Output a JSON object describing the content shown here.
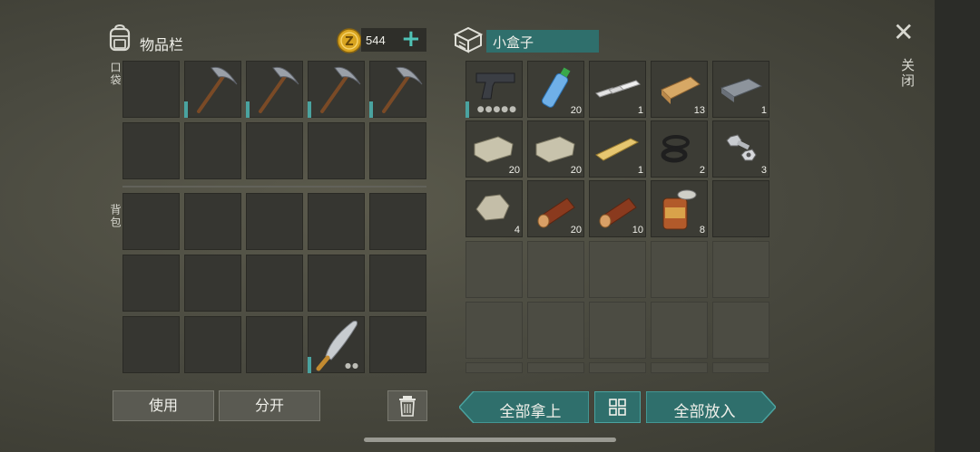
{
  "inventory": {
    "title": "物品栏",
    "coins": "544",
    "pocket_label": "口袋",
    "backpack_label": "背包",
    "icon": "backpack-icon"
  },
  "container": {
    "name": "小盒子",
    "icon": "box-icon",
    "items": [
      {
        "name": "pistol",
        "count": "",
        "dots": "●●●●●"
      },
      {
        "name": "water-bottle",
        "count": "20"
      },
      {
        "name": "metal-ingots",
        "count": "1"
      },
      {
        "name": "plank",
        "count": "13"
      },
      {
        "name": "iron-bar",
        "count": "1"
      },
      {
        "name": "stone-block",
        "count": "20"
      },
      {
        "name": "stone-block",
        "count": "20"
      },
      {
        "name": "light-plank",
        "count": "1"
      },
      {
        "name": "rubber-rings",
        "count": "2"
      },
      {
        "name": "nuts-and-bolts",
        "count": "3"
      },
      {
        "name": "rock",
        "count": "4"
      },
      {
        "name": "log",
        "count": "20"
      },
      {
        "name": "log",
        "count": "10"
      },
      {
        "name": "canned-food",
        "count": "8"
      }
    ]
  },
  "buttons": {
    "use": "使用",
    "split": "分开",
    "take_all": "全部拿上",
    "put_all": "全部放入",
    "close": "关闭",
    "close_glyph": "✕",
    "plus_glyph": "+"
  },
  "colors": {
    "accent": "#4aa3a0",
    "teal_button": "#2f6f6c"
  }
}
